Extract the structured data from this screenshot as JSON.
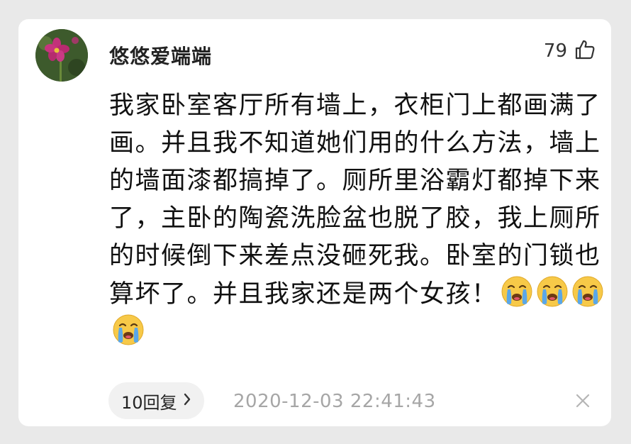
{
  "comment": {
    "username": "悠悠爱端端",
    "like_count": "79",
    "text": "我家卧室客厅所有墙上，衣柜门上都画满了画。并且我不知道她们用的什么方法，墙上的墙面漆都搞掉了。厕所里浴霸灯都掉下来了，主卧的陶瓷洗脸盆也脱了胶，我上厕所的时候倒下来差点没砸死我。卧室的门锁也算坏了。并且我家还是两个女孩！",
    "emojis": [
      "crying-face-icon",
      "crying-face-icon",
      "crying-face-icon",
      "crying-face-icon"
    ],
    "reply_label": "10回复",
    "timestamp": "2020-12-03 22:41:43"
  },
  "icons": {
    "like": "thumbs-up-icon",
    "reply_arrow": "chevron-right-icon",
    "close": "close-icon"
  },
  "colors": {
    "background": "#e9e9e9",
    "card": "#ffffff",
    "text": "#111111",
    "timestamp": "#a6a6a6",
    "reply_pill": "#f1f1f1"
  }
}
